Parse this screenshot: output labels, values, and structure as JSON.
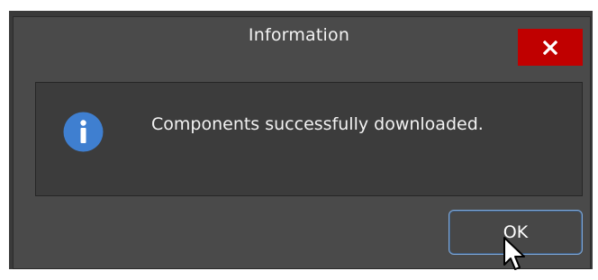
{
  "dialog": {
    "title": "Information",
    "message": "Components successfully downloaded.",
    "ok_label": "OK",
    "close_icon": "close-icon",
    "info_icon": "info-icon"
  },
  "colors": {
    "close_bg": "#c00000",
    "info_icon_bg": "#3f7fd0",
    "dialog_bg": "#4a4a4a",
    "panel_bg": "#3c3c3c",
    "button_border": "#7fa8d8"
  }
}
